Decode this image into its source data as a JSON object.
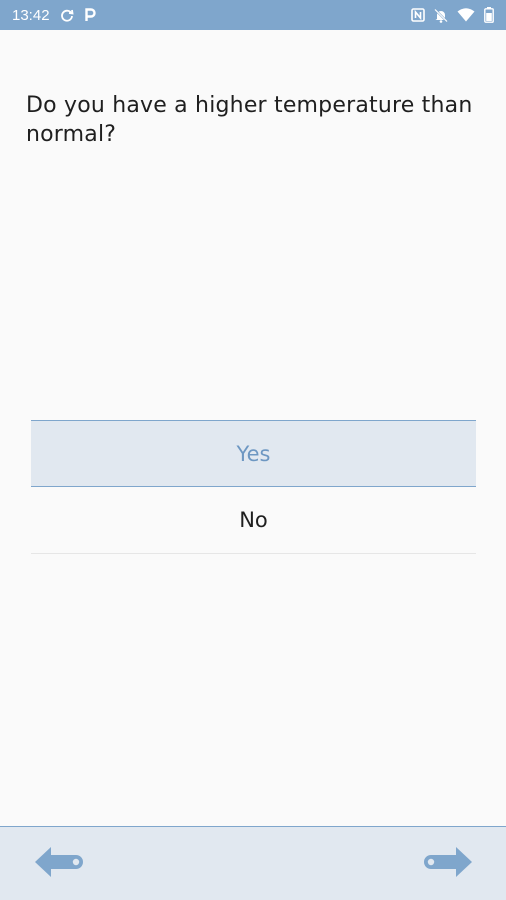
{
  "status_bar": {
    "time": "13:42",
    "icons_left": [
      "sync-icon",
      "parking-icon"
    ],
    "icons_right": [
      "nfc-icon",
      "notifications-off-icon",
      "wifi-icon",
      "battery-icon"
    ]
  },
  "question": {
    "text": "Do you have a higher temperature than normal?"
  },
  "options": [
    {
      "label": "Yes",
      "selected": true
    },
    {
      "label": "No",
      "selected": false
    }
  ],
  "navigation": {
    "back_icon": "arrow-left-icon",
    "next_icon": "arrow-right-icon"
  },
  "colors": {
    "accent": "#7fa6cc",
    "selected_bg": "#e1e8f0",
    "selected_text": "#6d97c2",
    "background": "#fafafa"
  }
}
